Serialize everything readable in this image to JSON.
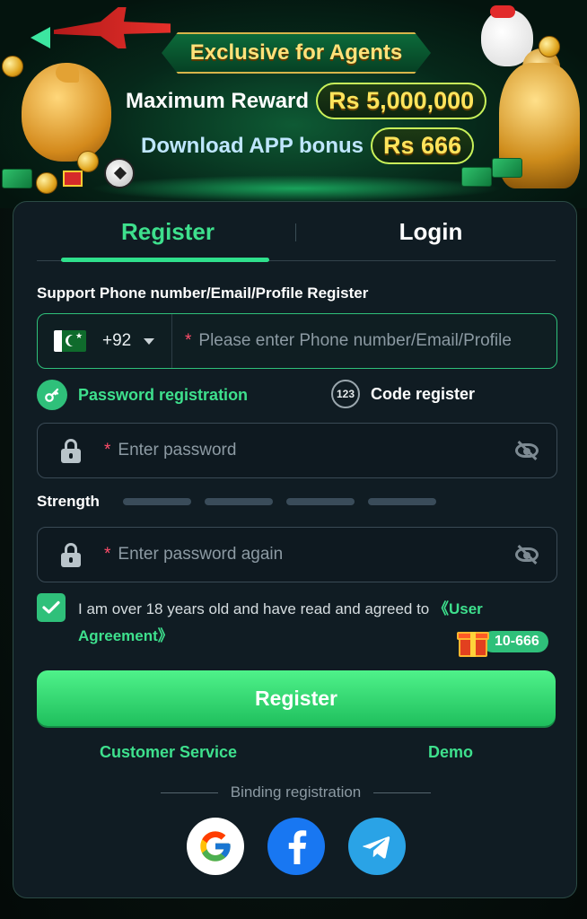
{
  "banner": {
    "title": "Exclusive for Agents",
    "max_reward_label": "Maximum Reward",
    "max_reward_value": "Rs 5,000,000",
    "app_bonus_label": "Download APP bonus",
    "app_bonus_value": "Rs 666"
  },
  "tabs": {
    "register": "Register",
    "login": "Login",
    "active": "register"
  },
  "form": {
    "section_label": "Support Phone number/Email/Profile Register",
    "country_code": "+92",
    "country_flag": "pakistan-flag",
    "phone_placeholder": "Please enter Phone number/Email/Profile",
    "mode_password": "Password registration",
    "mode_code_icon": "123",
    "mode_code": "Code register",
    "password_placeholder": "Enter password",
    "strength_label": "Strength",
    "strength_level": 0,
    "confirm_placeholder": "Enter password again",
    "required_mark": "*",
    "agree_checked": true,
    "agree_text": "I am over 18 years old and have read and agreed to ",
    "agree_link": "《User Agreement》",
    "bonus_badge": "10-666",
    "submit_label": "Register"
  },
  "footer": {
    "customer_service": "Customer Service",
    "demo": "Demo",
    "binding_label": "Binding registration",
    "socials": [
      "google-icon",
      "facebook-icon",
      "telegram-icon"
    ]
  },
  "colors": {
    "accent": "#3ee08d",
    "card_bg": "#101c23",
    "button_gradient_top": "#4ff28a",
    "button_gradient_bottom": "#1fbf5d",
    "required": "#ff4d6a"
  }
}
